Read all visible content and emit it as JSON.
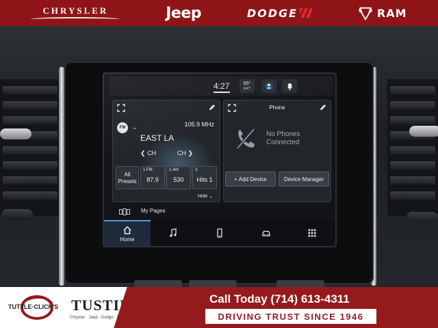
{
  "brands": {
    "chrysler": "CHRYSLER",
    "jeep": "Jeep",
    "dodge": "DODGE",
    "ram": "RAM"
  },
  "status": {
    "time": "4:27",
    "temp_value": "85°",
    "temp_label": "EXT"
  },
  "radio": {
    "band_badge": "FM",
    "frequency": "105.9 MHz",
    "station": "EAST LA",
    "seek_prev": "CH",
    "seek_next": "CH",
    "all_presets": "All Presets",
    "presets": [
      {
        "num": "1.FM",
        "value": "87.9"
      },
      {
        "num": "2.AM",
        "value": "530"
      },
      {
        "num": "3",
        "value": "Hits 1"
      }
    ],
    "hide_label": "Hide"
  },
  "phone": {
    "title": "Phone",
    "status_line1": "No Phones",
    "status_line2": "Connected",
    "add_device": "+ Add Device",
    "device_manager": "Device Manager"
  },
  "my_pages": "My Pages",
  "nav": {
    "home": "Home",
    "active_color": "#4aa3e0"
  },
  "dealer": {
    "tc_name": "TUTTLE·CLICK'S",
    "tustin": "TUSTIN",
    "tustin_brands": "Chrysler · Jeep · Dodge · Ram",
    "call_today": "Call Today (714) 613-4311",
    "slogan": "DRIVING TRUST SINCE 1946",
    "brand_red": "#951a1d"
  }
}
